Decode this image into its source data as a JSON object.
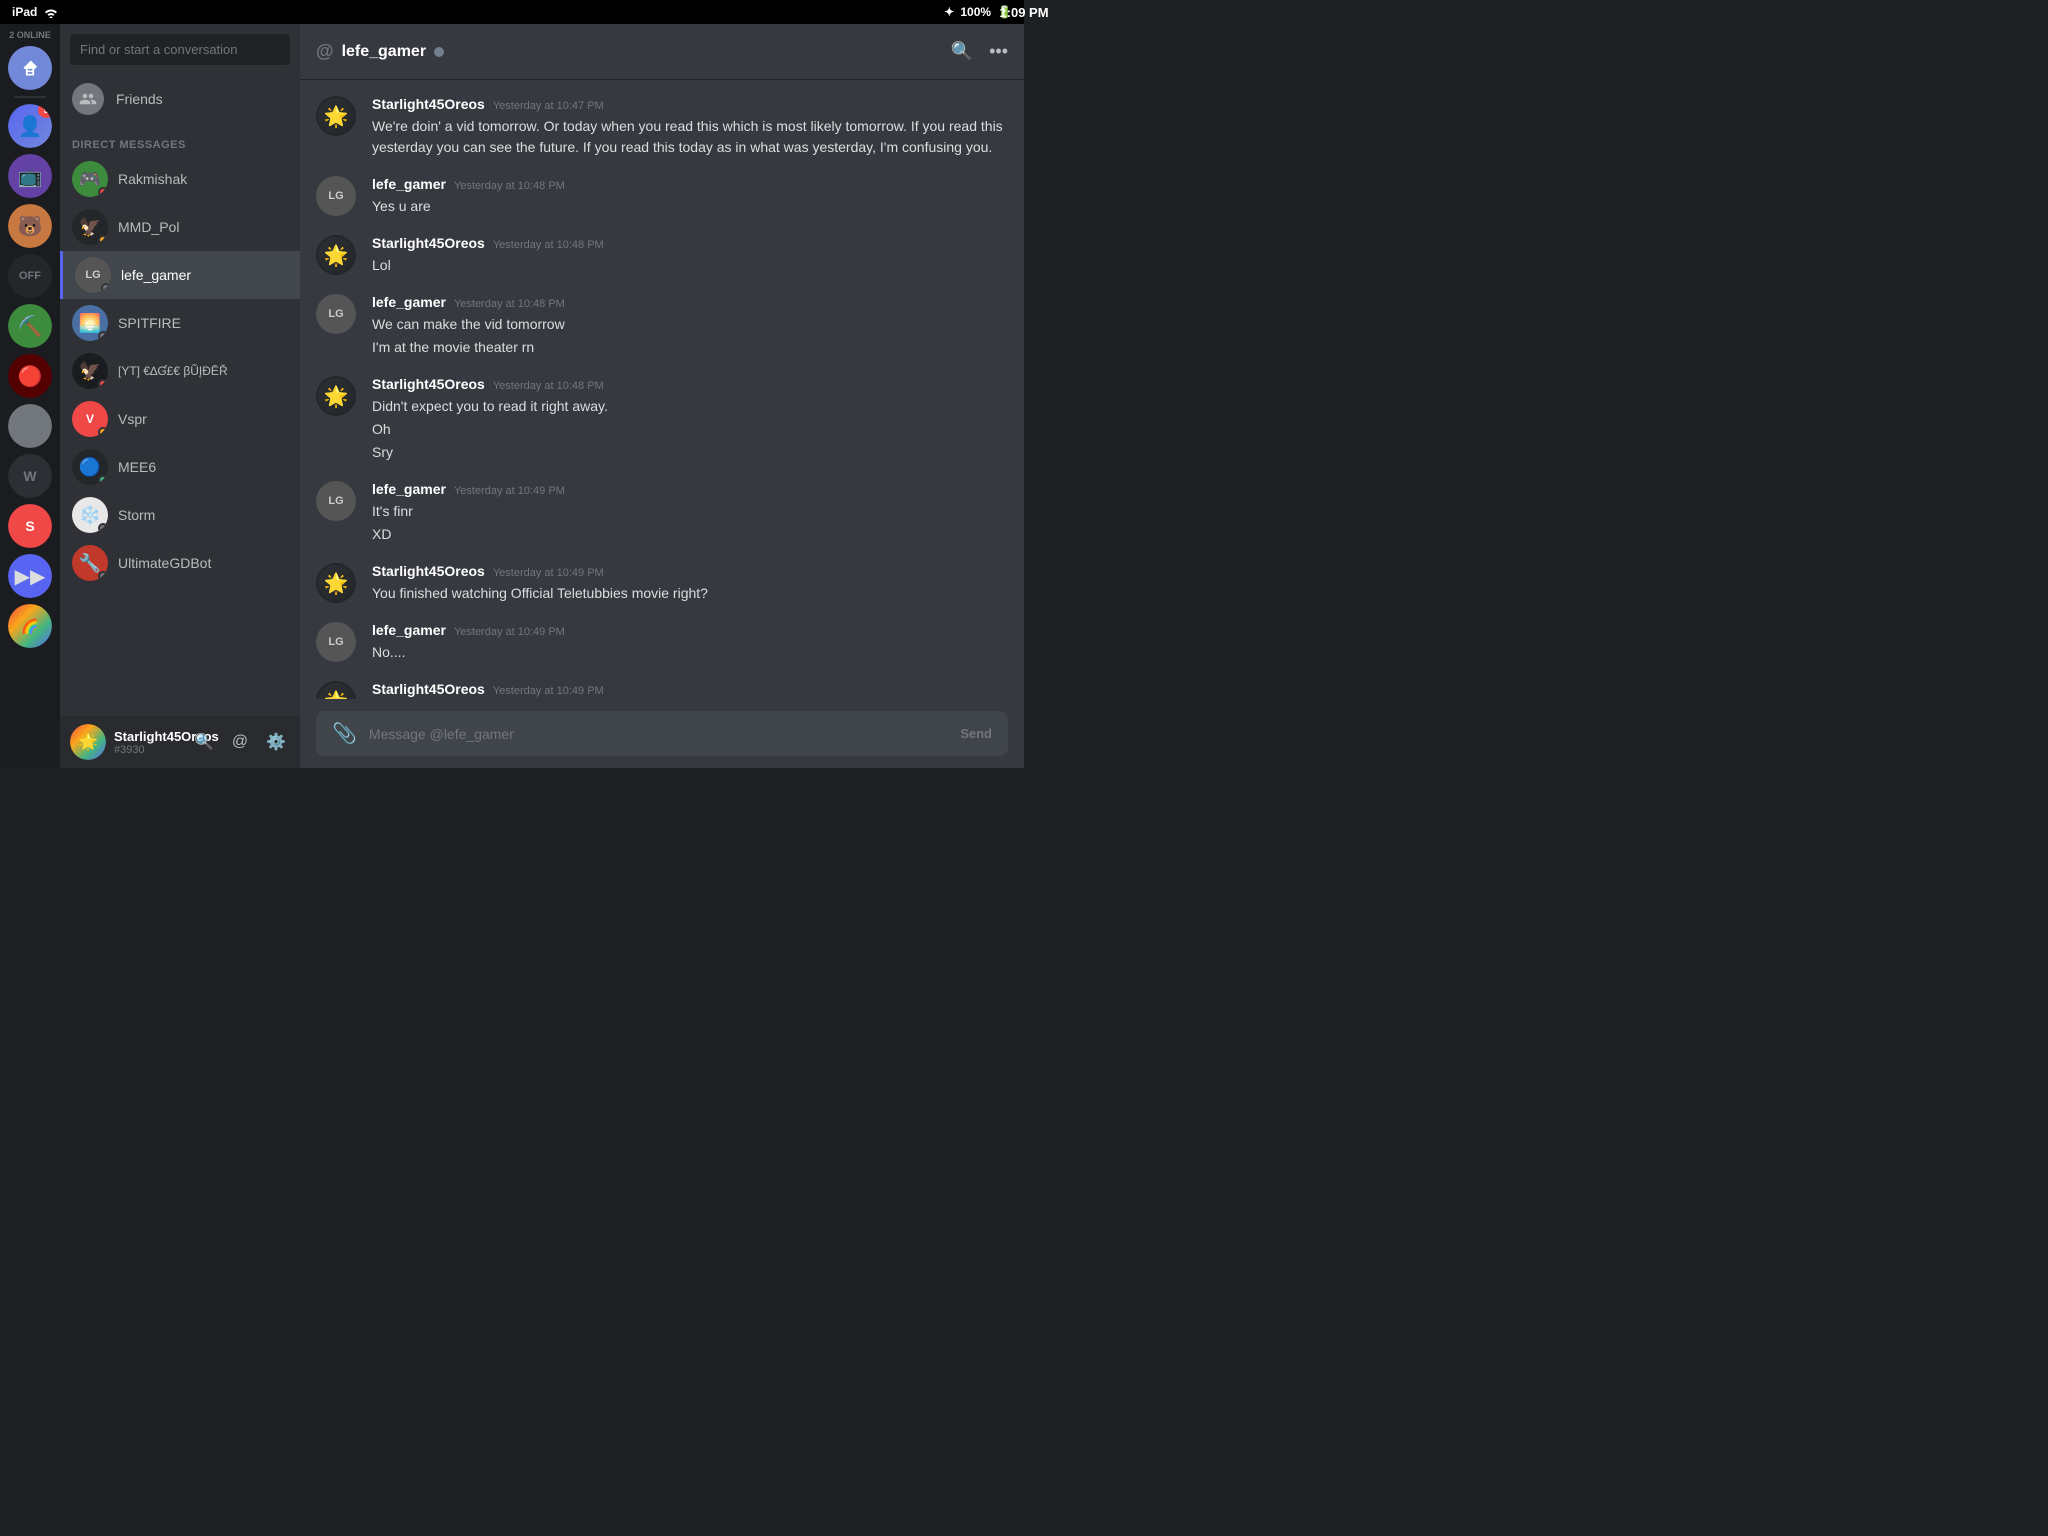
{
  "statusBar": {
    "left": "iPad",
    "time": "1:09 PM",
    "battery": "100%"
  },
  "serverSidebar": {
    "onlineCount": "2 ONLINE",
    "servers": [
      {
        "id": "dm",
        "label": "Direct Messages",
        "type": "dm"
      },
      {
        "id": "s1",
        "label": "Server with badge 5",
        "badge": "5",
        "color": "#5865f2"
      },
      {
        "id": "s2",
        "label": "Twitch server",
        "color": "#6441a5"
      },
      {
        "id": "s3",
        "label": "Bear server",
        "color": "#d4823a"
      },
      {
        "id": "s4",
        "label": "Official Server",
        "color": "#2c2f33"
      },
      {
        "id": "s5",
        "label": "Minecraft server",
        "color": "#3d8b3d"
      },
      {
        "id": "s6",
        "label": "Red server",
        "color": "#500"
      },
      {
        "id": "s7",
        "label": "Gray server",
        "color": "#72767d"
      },
      {
        "id": "s8",
        "label": "W server",
        "color": "#2c2f33"
      },
      {
        "id": "s9",
        "label": "S server",
        "color": "#f04747"
      },
      {
        "id": "s10",
        "label": "Arrow server",
        "color": "#5865f2"
      },
      {
        "id": "s11",
        "label": "Colorful server",
        "color": "#23272a"
      }
    ]
  },
  "dmSidebar": {
    "searchPlaceholder": "Find or start a conversation",
    "friends": {
      "label": "Friends",
      "icon": "friends-icon"
    },
    "directMessagesHeader": "DIRECT MESSAGES",
    "dmList": [
      {
        "name": "Rakmishak",
        "status": "red",
        "active": false
      },
      {
        "name": "MMD_Pol",
        "status": "yellow",
        "active": false
      },
      {
        "name": "lefe_gamer",
        "status": "offline",
        "active": true
      },
      {
        "name": "SPITFIRE",
        "status": "offline",
        "active": false
      },
      {
        "name": "[YT] €∆Ɠ£€ βŨĮĐĒŘ",
        "status": "red",
        "active": false
      },
      {
        "name": "Vspr",
        "status": "yellow",
        "active": false
      },
      {
        "name": "MEE6",
        "status": "online",
        "active": false
      },
      {
        "name": "Storm",
        "status": "offline",
        "active": false
      },
      {
        "name": "UltimateGDBot",
        "status": "offline",
        "active": false
      }
    ]
  },
  "userPanel": {
    "name": "Starlight45Oreos",
    "tag": "#3930",
    "actions": [
      "search-icon",
      "mention-icon",
      "settings-icon"
    ]
  },
  "chatHeader": {
    "atSymbol": "@",
    "username": "lefe_gamer",
    "status": "offline",
    "searchIcon": "search-icon",
    "moreIcon": "more-icon"
  },
  "messages": [
    {
      "id": "m1",
      "author": "Starlight45Oreos",
      "timestamp": "Yesterday at 10:47 PM",
      "avatar": "star",
      "lines": [
        "We're doin' a vid tomorrow. Or today when you read this which is most likely tomorrow. If you read this yesterday you can see the future. If you read this today as in what was yesterday, I'm confusing you."
      ]
    },
    {
      "id": "m2",
      "author": "lefe_gamer",
      "timestamp": "Yesterday at 10:48 PM",
      "avatar": "lefe",
      "lines": [
        "Yes u are"
      ]
    },
    {
      "id": "m3",
      "author": "Starlight45Oreos",
      "timestamp": "Yesterday at 10:48 PM",
      "avatar": "star",
      "lines": [
        "Lol"
      ]
    },
    {
      "id": "m4",
      "author": "lefe_gamer",
      "timestamp": "Yesterday at 10:48 PM",
      "avatar": "lefe",
      "lines": [
        "We can make the vid tomorrow",
        "I'm at the movie theater rn"
      ]
    },
    {
      "id": "m5",
      "author": "Starlight45Oreos",
      "timestamp": "Yesterday at 10:48 PM",
      "avatar": "star",
      "lines": [
        "Didn't expect you to read it right away.",
        "Oh",
        "Sry"
      ]
    },
    {
      "id": "m6",
      "author": "lefe_gamer",
      "timestamp": "Yesterday at 10:49 PM",
      "avatar": "lefe",
      "lines": [
        "It's finr",
        "XD"
      ]
    },
    {
      "id": "m7",
      "author": "Starlight45Oreos",
      "timestamp": "Yesterday at 10:49 PM",
      "avatar": "star",
      "lines": [
        "You finished watching Official Teletubbies movie right?"
      ]
    },
    {
      "id": "m8",
      "author": "lefe_gamer",
      "timestamp": "Yesterday at 10:49 PM",
      "avatar": "lefe",
      "lines": [
        "No...."
      ]
    },
    {
      "id": "m9",
      "author": "Starlight45Oreos",
      "timestamp": "Yesterday at 10:49 PM",
      "avatar": "star",
      "lines": []
    }
  ],
  "messageInput": {
    "placeholder": "Message @lefe_gamer",
    "sendLabel": "Send"
  }
}
